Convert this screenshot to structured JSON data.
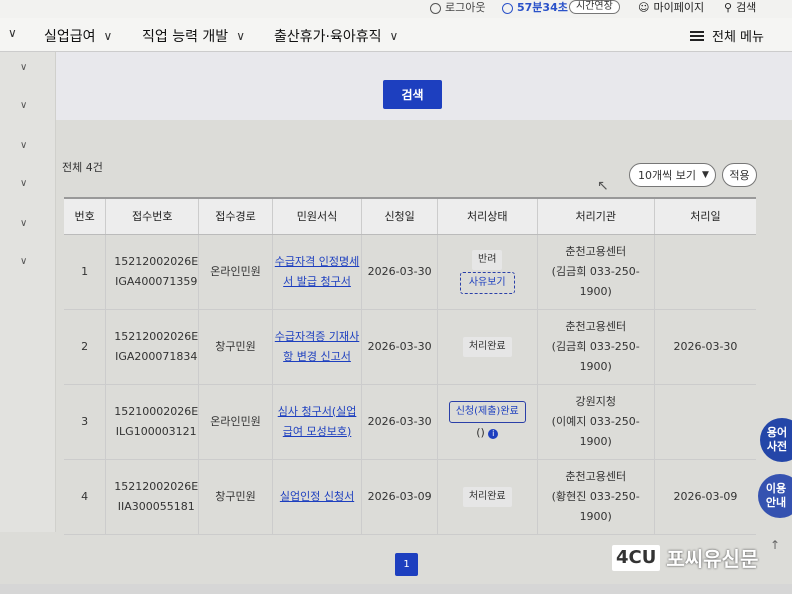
{
  "topbar": {
    "logout": "로그아웃",
    "timer": "57분34초",
    "extend": "시간연장",
    "mypage": "마이페이지",
    "search": "검색"
  },
  "nav": {
    "items": [
      "실업급여",
      "직업 능력 개발",
      "출산휴가·육아휴직"
    ],
    "all_menu": "전체 메뉴"
  },
  "search_button": "검색",
  "total_label": "전체 4건",
  "page_size": {
    "selected": "10개씩 보기"
  },
  "apply_button": "적용",
  "table": {
    "headers": [
      "번호",
      "접수번호",
      "접수경로",
      "민원서식",
      "신청일",
      "처리상태",
      "처리기관",
      "처리일"
    ],
    "rows": [
      {
        "no": "1",
        "rec1": "15212002026E",
        "rec2": "IGA400071359",
        "route": "온라인민원",
        "form1": "수급자격 인정명세",
        "form2": "서 발급 청구서",
        "date": "2026-03-30",
        "status": "반려",
        "status_btn": "사유보기",
        "org1": "춘천고용센터",
        "org2": "(김금희 033-250-",
        "org3": "1900)",
        "pdate": ""
      },
      {
        "no": "2",
        "rec1": "15212002026E",
        "rec2": "IGA200071834",
        "route": "창구민원",
        "form1": "수급자격증 기재사",
        "form2": "항 변경 신고서",
        "date": "2026-03-30",
        "status": "처리완료",
        "org1": "춘천고용센터",
        "org2": "(김금희 033-250-",
        "org3": "1900)",
        "pdate": "2026-03-30"
      },
      {
        "no": "3",
        "rec1": "15210002026E",
        "rec2": "ILG100003121",
        "route": "온라인민원",
        "form1": "심사 청구서(실업",
        "form2": "급여 모성보호)",
        "date": "2026-03-30",
        "status_btn": "신청(제출)완료",
        "status_sub": "()",
        "org1": "강원지청",
        "org2": "(이예지 033-250-",
        "org3": "1900)",
        "pdate": ""
      },
      {
        "no": "4",
        "rec1": "15212002026E",
        "rec2": "IIA300055181",
        "route": "창구민원",
        "form1": "실업인정 신청서",
        "date": "2026-03-09",
        "status": "처리완료",
        "org1": "춘천고용센터",
        "org2": "(황현진 033-250-",
        "org3": "1900)",
        "pdate": "2026-03-09"
      }
    ]
  },
  "pagination": {
    "current": "1"
  },
  "floating": {
    "glossary_1": "용어",
    "glossary_2": "사전",
    "guide_1": "이용",
    "guide_2": "안내"
  },
  "watermark": {
    "logo": "4CU",
    "text": "포씨유신문"
  }
}
